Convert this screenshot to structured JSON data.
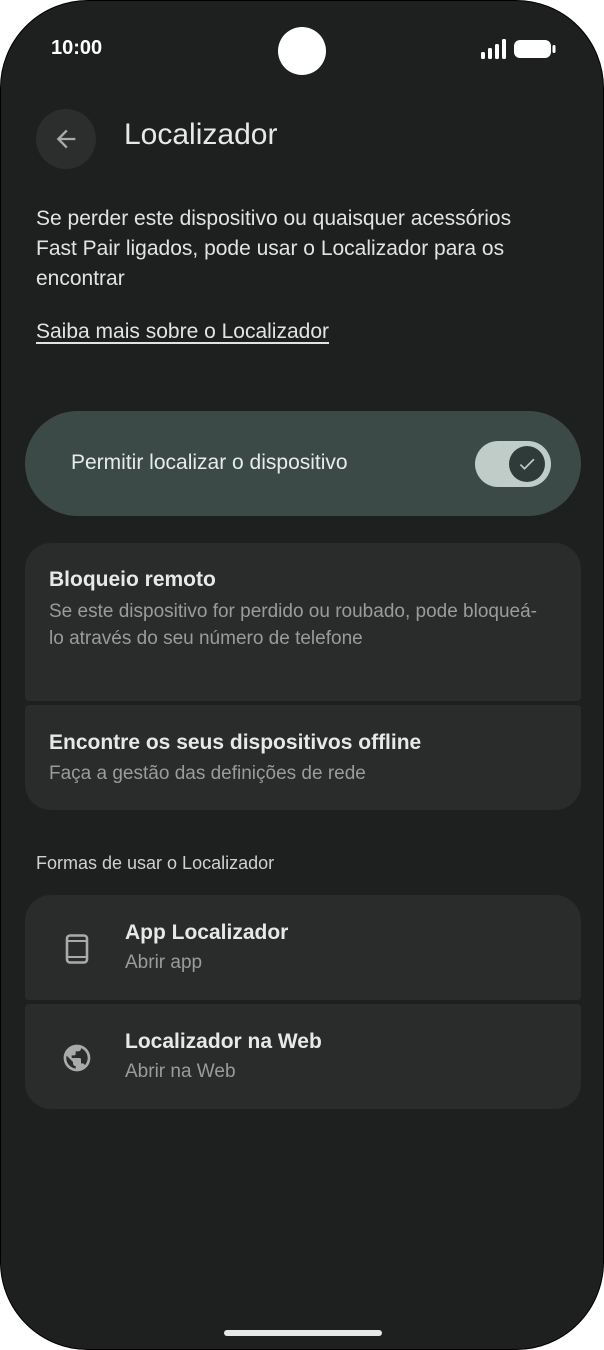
{
  "status_bar": {
    "time": "10:00",
    "signal_icon": "signal-icon",
    "battery_icon": "battery-icon"
  },
  "header": {
    "back_icon": "arrow-back-icon",
    "title": "Localizador"
  },
  "intro": {
    "description": "Se perder este dispositivo ou quaisquer acessórios Fast Pair ligados, pode usar o Localizador para os encontrar",
    "link": "Saiba mais sobre o Localizador"
  },
  "toggle": {
    "label": "Permitir localizar o dispositivo",
    "checked": true,
    "icon": "check-icon"
  },
  "settings": [
    {
      "title": "Bloqueio remoto",
      "subtitle": "Se este dispositivo for perdido ou roubado, pode bloqueá-lo através do seu número de telefone"
    },
    {
      "title": "Encontre os seus dispositivos offline",
      "subtitle": "Faça a gestão das definições de rede"
    }
  ],
  "ways": {
    "header": "Formas de usar o Localizador",
    "items": [
      {
        "icon": "phone-icon",
        "title": "App Localizador",
        "subtitle": "Abrir app"
      },
      {
        "icon": "globe-icon",
        "title": "Localizador na Web",
        "subtitle": "Abrir na Web"
      }
    ]
  },
  "colors": {
    "background": "#1e1f1f",
    "card": "#2a2b2b",
    "toggle_card": "#3c4a47",
    "switch_track": "#c0ccc8",
    "switch_thumb": "#2f3b38"
  }
}
